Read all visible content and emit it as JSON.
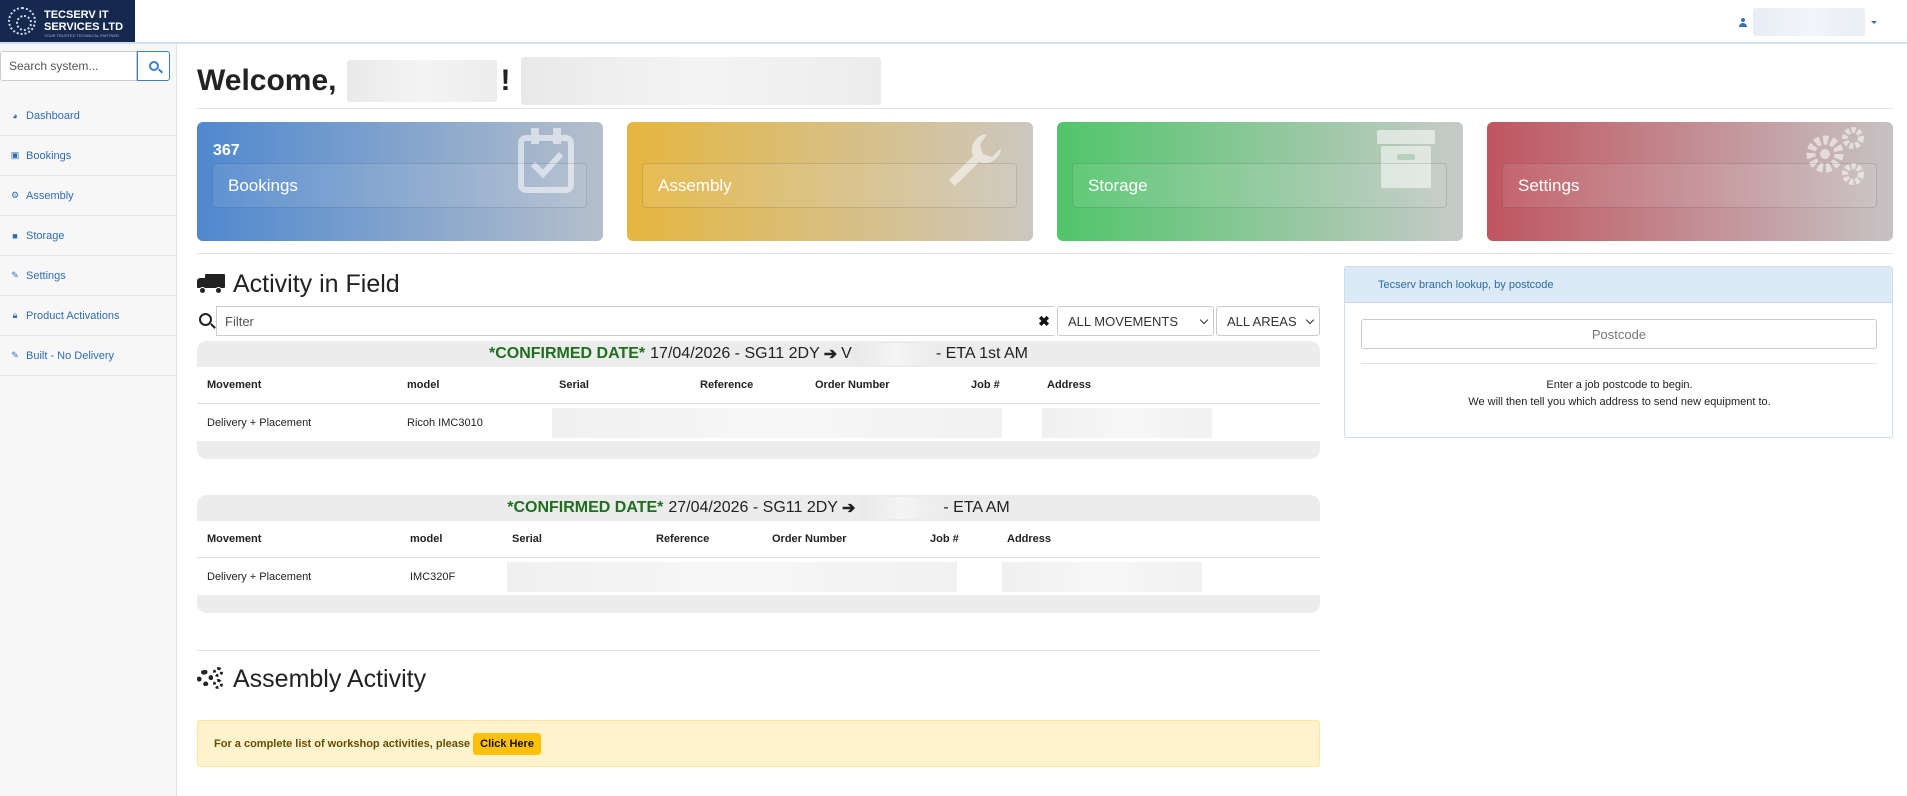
{
  "brand": {
    "logo_text_line1": "TECSERV IT",
    "logo_text_line2": "SERVICES LTD",
    "tagline": "YOUR TRUSTED TECHNICAL PARTNER"
  },
  "user_menu": {
    "name": ""
  },
  "sidebar": {
    "search_placeholder": "Search system...",
    "items": [
      {
        "label": "Dashboard",
        "icon": "dashboard-icon"
      },
      {
        "label": "Bookings",
        "icon": "calendar-icon"
      },
      {
        "label": "Assembly",
        "icon": "gears-icon"
      },
      {
        "label": "Storage",
        "icon": "archive-icon"
      },
      {
        "label": "Settings",
        "icon": "wrench-icon"
      },
      {
        "label": "Product Activations",
        "icon": "lock-icon"
      },
      {
        "label": "Built - No Delivery",
        "icon": "wrench-icon"
      }
    ]
  },
  "welcome": {
    "prefix": "Welcome,",
    "suffix": "!"
  },
  "tiles": [
    {
      "count": "367",
      "label": "Bookings",
      "icon": "calendar-check-icon",
      "color": "#4f88cf"
    },
    {
      "count": "",
      "label": "Assembly",
      "icon": "wrench-icon",
      "color": "#e5b63f"
    },
    {
      "count": "",
      "label": "Storage",
      "icon": "archive-icon",
      "color": "#50c56a"
    },
    {
      "count": "",
      "label": "Settings",
      "icon": "gears-icon",
      "color": "#bf5560"
    }
  ],
  "activity": {
    "title": "Activity in Field",
    "filter_placeholder": "Filter",
    "movements_select": "ALL MOVEMENTS",
    "areas_select": "ALL AREAS",
    "columns": [
      "Movement",
      "model",
      "Serial",
      "Reference",
      "Order Number",
      "Job #",
      "Address"
    ],
    "movements": [
      {
        "confirmed": "*CONFIRMED DATE*",
        "date": "17/04/2026",
        "postcode": "SG11 2DY",
        "dest_prefix": "V",
        "eta": "- ETA 1st AM",
        "row": {
          "movement": "Delivery + Placement",
          "model": "Ricoh IMC3010"
        }
      },
      {
        "confirmed": "*CONFIRMED DATE*",
        "date": "27/04/2026",
        "postcode": "SG11 2DY",
        "dest_prefix": "",
        "eta": "- ETA AM",
        "row": {
          "movement": "Delivery + Placement",
          "model": "IMC320F"
        }
      }
    ]
  },
  "assembly": {
    "title": "Assembly Activity",
    "notice_text": "For a complete list of workshop activities, please",
    "notice_button": "Click Here"
  },
  "branch_lookup": {
    "title": "Tecserv branch lookup, by postcode",
    "input_placeholder": "Postcode",
    "line1": "Enter a job postcode to begin.",
    "line2": "We will then tell you which address to send new equipment to."
  }
}
